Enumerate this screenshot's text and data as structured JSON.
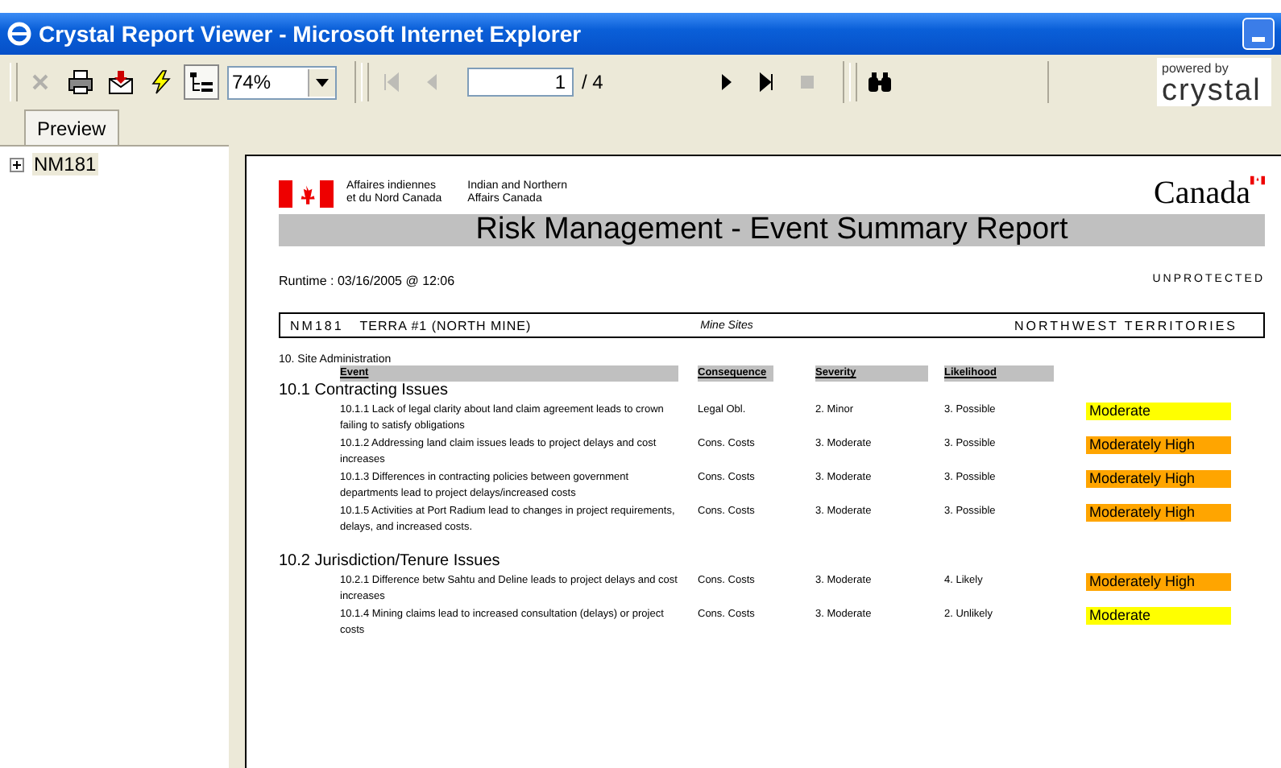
{
  "window": {
    "title": "Crystal Report Viewer - Microsoft Internet Explorer"
  },
  "toolbar": {
    "buttons": [
      {
        "kind": "close",
        "disabled": true
      },
      {
        "kind": "print",
        "disabled": false
      },
      {
        "kind": "export",
        "disabled": false
      },
      {
        "kind": "refresh",
        "disabled": false
      },
      {
        "kind": "tree",
        "disabled": false,
        "pressed": true
      }
    ],
    "zoom": "74%",
    "page": "1",
    "page_total": "/ 4",
    "nav": [
      {
        "kind": "first",
        "disabled": true
      },
      {
        "kind": "prev",
        "disabled": true
      },
      {
        "kind": "next",
        "disabled": false
      },
      {
        "kind": "last",
        "disabled": false
      },
      {
        "kind": "stop",
        "disabled": true
      }
    ],
    "logo": {
      "caption": "powered by",
      "name": "crystal"
    }
  },
  "tabs": [
    {
      "label": "Preview",
      "selected": true
    }
  ],
  "tree": [
    {
      "label": "NM181",
      "expanded": false
    }
  ],
  "report": {
    "agency_fr": "Affaires indiennes\net du Nord Canada",
    "agency_en": "Indian and Northern\nAffairs Canada",
    "wordmark": "Canada",
    "title": "Risk Management - Event Summary Report",
    "runtime": "Runtime : 03/16/2005 @  12:06",
    "classification": "UNPROTECTED",
    "site": {
      "code": "NM181",
      "name": "TERRA #1 (NORTH MINE)",
      "type": "Mine Sites",
      "region": "NORTHWEST TERRITORIES"
    },
    "category": "10. Site Administration",
    "columns": [
      "Event",
      "Consequence",
      "Severity",
      "Likelihood"
    ],
    "sections": [
      {
        "title": "10.1 Contracting Issues",
        "rows": [
          {
            "event": "10.1.1 Lack of legal clarity about land claim agreement leads to crown failing to satisfy obligations",
            "consequence": "Legal Obl.",
            "severity": "2. Minor",
            "likelihood": "3. Possible",
            "rating": "Moderate",
            "color": "#ffff00"
          },
          {
            "event": "10.1.2 Addressing land claim issues leads to project delays and cost increases",
            "consequence": "Cons. Costs",
            "severity": "3. Moderate",
            "likelihood": "3. Possible",
            "rating": "Moderately High",
            "color": "#ffa500"
          },
          {
            "event": "10.1.3 Differences in contracting policies between government departments lead to project delays/increased costs",
            "consequence": "Cons. Costs",
            "severity": "3. Moderate",
            "likelihood": "3. Possible",
            "rating": "Moderately High",
            "color": "#ffa500"
          },
          {
            "event": "10.1.5 Activities at Port Radium lead to changes in project requirements, delays, and increased costs.",
            "consequence": "Cons. Costs",
            "severity": "3. Moderate",
            "likelihood": "3. Possible",
            "rating": "Moderately High",
            "color": "#ffa500"
          }
        ]
      },
      {
        "title": "10.2 Jurisdiction/Tenure Issues",
        "rows": [
          {
            "event": "10.2.1 Difference betw Sahtu and Deline leads to project delays and cost increases",
            "consequence": "Cons. Costs",
            "severity": "3. Moderate",
            "likelihood": "4. Likely",
            "rating": "Moderately High",
            "color": "#ffa500"
          },
          {
            "event": "10.1.4 Mining claims lead to increased consultation (delays) or project costs",
            "consequence": "Cons. Costs",
            "severity": "3. Moderate",
            "likelihood": "2. Unlikely",
            "rating": "Moderate",
            "color": "#ffff00"
          }
        ]
      }
    ]
  }
}
